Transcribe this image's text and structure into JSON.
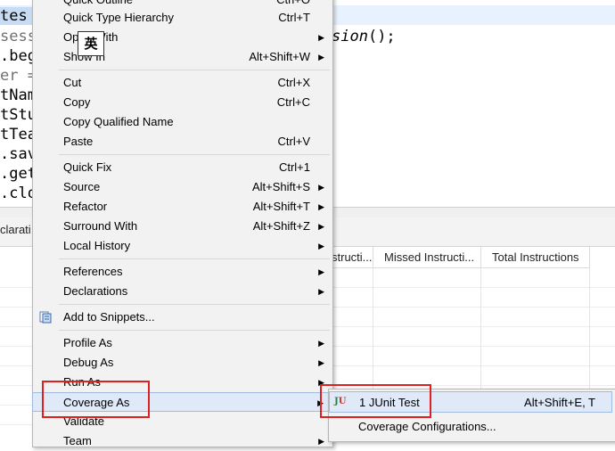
{
  "editor": {
    "lines": [
      "tes",
      "sess",
      ".beg",
      "er =",
      "tNam",
      "tStu",
      "tTea",
      ".sav",
      ".get",
      ".clo"
    ],
    "right_code_italic": "sion",
    "right_code_rest": "();"
  },
  "ime_indicator": "英",
  "lower_view": {
    "tab_label": "clarati",
    "columns": [
      "structi...",
      "Missed Instructi...",
      "Total Instructions"
    ]
  },
  "context_menu": {
    "items": [
      {
        "label": "Quick Outline",
        "accel": "Ctrl+O"
      },
      {
        "label": "Quick Type Hierarchy",
        "accel": "Ctrl+T"
      },
      {
        "label": "Open With",
        "accel": "",
        "sub": true
      },
      {
        "label": "Show In",
        "accel": "Alt+Shift+W",
        "sub": true
      },
      {
        "label": "Cut",
        "accel": "Ctrl+X"
      },
      {
        "label": "Copy",
        "accel": "Ctrl+C"
      },
      {
        "label": "Copy Qualified Name",
        "accel": ""
      },
      {
        "label": "Paste",
        "accel": "Ctrl+V"
      },
      {
        "label": "Quick Fix",
        "accel": "Ctrl+1"
      },
      {
        "label": "Source",
        "accel": "Alt+Shift+S",
        "sub": true
      },
      {
        "label": "Refactor",
        "accel": "Alt+Shift+T",
        "sub": true
      },
      {
        "label": "Surround With",
        "accel": "Alt+Shift+Z",
        "sub": true
      },
      {
        "label": "Local History",
        "accel": "",
        "sub": true
      },
      {
        "label": "References",
        "accel": "",
        "sub": true
      },
      {
        "label": "Declarations",
        "accel": "",
        "sub": true
      },
      {
        "label": "Add to Snippets...",
        "accel": ""
      },
      {
        "label": "Profile As",
        "accel": "",
        "sub": true
      },
      {
        "label": "Debug As",
        "accel": "",
        "sub": true
      },
      {
        "label": "Run As",
        "accel": "",
        "sub": true
      },
      {
        "label": "Coverage As",
        "accel": "",
        "sub": true
      },
      {
        "label": "Validate",
        "accel": ""
      },
      {
        "label": "Team",
        "accel": "",
        "sub": true
      }
    ]
  },
  "coverage_submenu": {
    "items": [
      {
        "label": "1 JUnit Test",
        "accel": "Alt+Shift+E, T"
      },
      {
        "label": "Coverage Configurations...",
        "accel": ""
      }
    ]
  },
  "colors": {
    "menu_bg": "#f2f2f2",
    "highlight_bg": "#dfe9f7",
    "annotation_red": "#e02020"
  }
}
